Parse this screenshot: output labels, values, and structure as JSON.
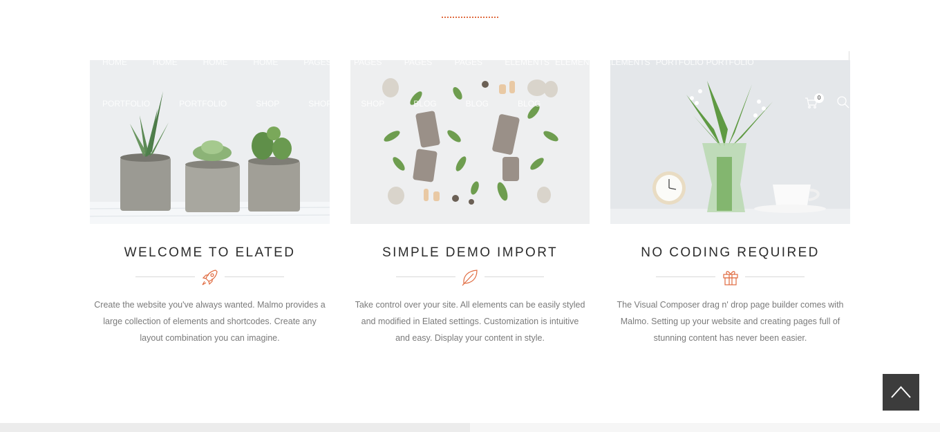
{
  "nav": {
    "row1": [
      "Home",
      "Home",
      "Home",
      "Home",
      "Pages",
      "Pages",
      "Pages",
      "Pages",
      "Elements",
      "Elements",
      "Elements",
      "Portfolio",
      "Portfolio"
    ],
    "row2": [
      "Portfolio",
      "Portfolio",
      "Shop",
      "Shop",
      "Shop",
      "Blog",
      "Blog",
      "Blog"
    ],
    "cart_count": "0"
  },
  "cards": [
    {
      "title": "WELCOME TO ELATED",
      "icon": "rocket-icon",
      "text": "Create the website you've always wanted. Malmo provides a large collection of elements and shortcodes. Create any layout combination you can imagine."
    },
    {
      "title": "SIMPLE DEMO IMPORT",
      "icon": "leaf-icon",
      "text": "Take control over your site. All elements can be easily styled and modified in Elated settings. Customization is intuitive and easy. Display your content in style."
    },
    {
      "title": "NO CODING REQUIRED",
      "icon": "gift-icon",
      "text": "The Visual Composer drag n' drop page builder comes with Malmo. Setting up your website and creating pages full of stunning content has never been easier."
    }
  ],
  "colors": {
    "accent": "#e06a3f",
    "scroll_top_bg": "#3c3c3c",
    "title": "#2b2b2b",
    "body_text": "#7a7a7a"
  }
}
